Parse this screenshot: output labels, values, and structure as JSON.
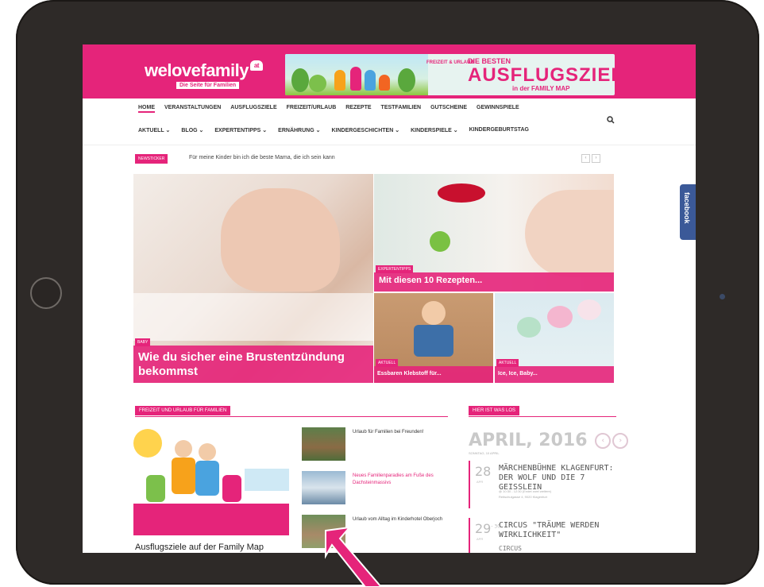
{
  "site": {
    "logo": "welovefamily",
    "logo_badge": "at",
    "tagline": "Die Seite für Familien"
  },
  "banner": {
    "small": "FREIZEIT & URLAUB",
    "top": "DIE BESTEN",
    "main": "AUSFLUGSZIELE",
    "sub": "in der FAMILY MAP"
  },
  "nav_primary": [
    "HOME",
    "VERANSTALTUNGEN",
    "AUSFLUGSZIELE",
    "FREIZEIT/URLAUB",
    "REZEPTE",
    "TESTFAMILIEN",
    "GUTSCHEINE",
    "GEWINNSPIELE"
  ],
  "nav_secondary": [
    "AKTUELL ⌄",
    "BLOG ⌄",
    "EXPERTENTIPPS ⌄",
    "ERNÄHRUNG ⌄",
    "KINDERGESCHICHTEN ⌄",
    "KINDERSPIELE ⌄",
    "KINDERGEBURTSTAG"
  ],
  "ticker": {
    "label": "NEWSTICKER",
    "text": "Für meine Kinder bin ich die beste Mama, die ich sein kann",
    "prev": "‹",
    "next": "›"
  },
  "facebook_tab": "facebook",
  "hero": {
    "main": {
      "category": "BABY",
      "title": "Wie du sicher eine Brustentzündung bekommst"
    },
    "top_right": {
      "category": "EXPERTENTIPPS",
      "title": "Mit diesen 10 Rezepten..."
    },
    "bottom_left": {
      "category": "AKTUELL",
      "title": "Essbaren Klebstoff für..."
    },
    "bottom_right": {
      "category": "AKTUELL",
      "title": "Ice, Ice, Baby..."
    }
  },
  "section_left": {
    "label": "FREIZEIT UND URLAUB FÜR FAMILIEN",
    "feature_title": "Ausflugsziele auf der Family Map",
    "items": [
      {
        "text": "Urlaub für Familien bei Freunden!",
        "color": "#333333"
      },
      {
        "text": "Neues Familienparadies am Fuße des Dachsteinmassivs",
        "color": "#e5247a"
      },
      {
        "text": "Urlaub vom Alltag im Kinderhotel Oberjoch",
        "color": "#333333"
      }
    ]
  },
  "section_right": {
    "label": "HIER IST WAS LOS",
    "month": "APRIL, 2016",
    "month_sub": "SONNTAG, 10 APRIL",
    "events": [
      {
        "day": "28",
        "mon": "APR",
        "title": "MÄRCHENBÜHNE KLAGENFURT: DER WOLF UND DIE 7 GEISSLEIN",
        "time": "@ 10:30 - 12:30 (Endet zwei weitere)",
        "place": "Reitschulgasse 4, 9020 Klagenfurt"
      },
      {
        "day": "29",
        "sup": "- 30",
        "mon": "APR",
        "title": "CIRCUS \"TRÄUME WERDEN WIRKLICHKEIT\"",
        "subtitle": "CIRCUS"
      }
    ]
  },
  "colors": {
    "brand": "#e5247a",
    "tablet": "#2e2a28",
    "facebook": "#3b5998"
  }
}
